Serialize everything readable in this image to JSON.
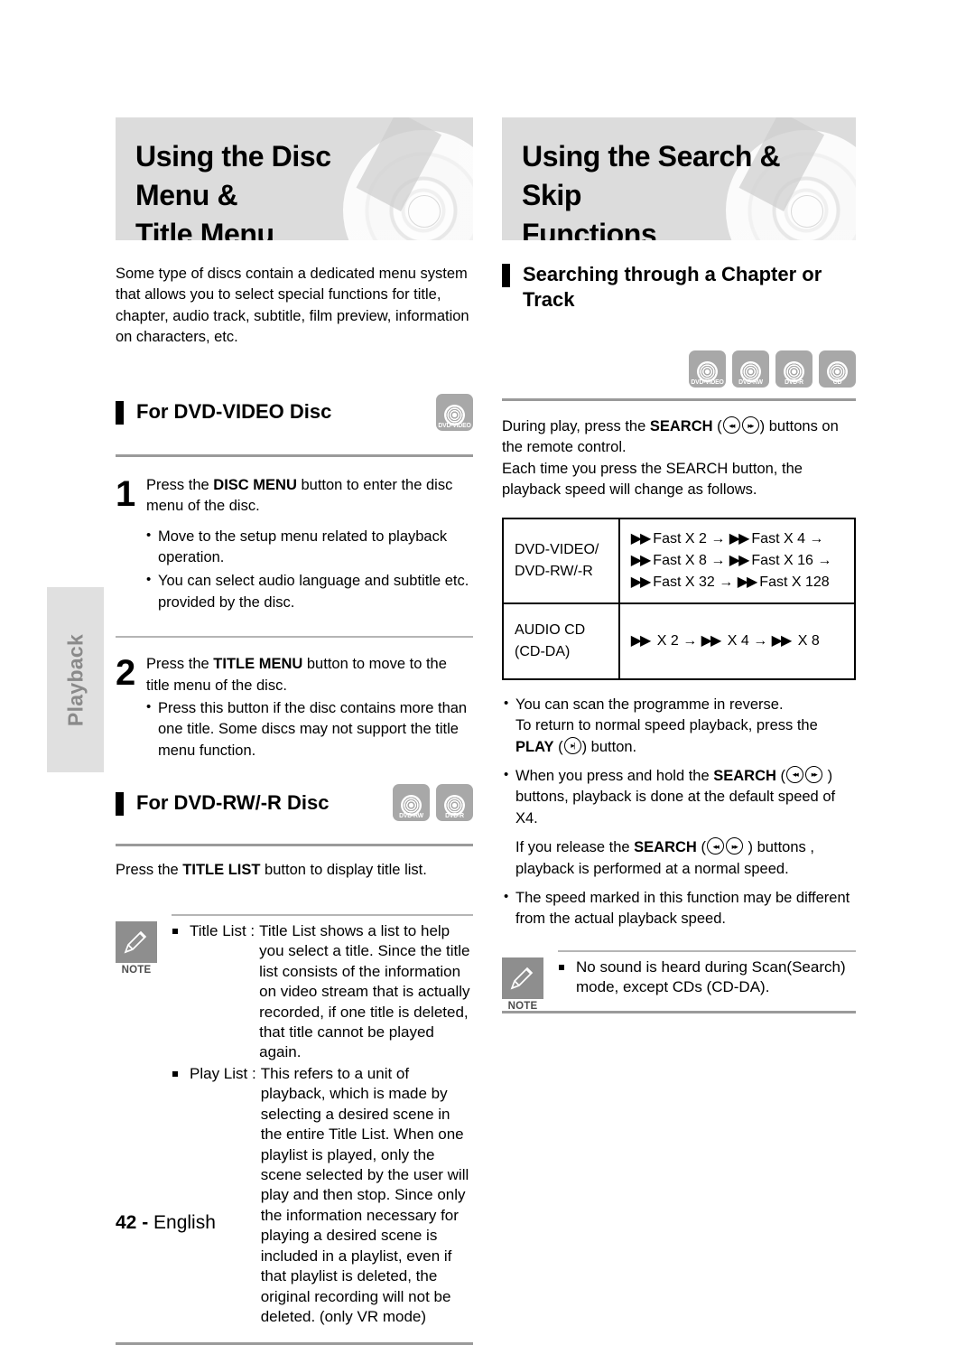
{
  "side_tab": {
    "label": "Playback"
  },
  "footer": {
    "page_number": "42 -",
    "language": "English"
  },
  "left": {
    "banner_title_line1": "Using the Disc Menu &",
    "banner_title_line2": "Title Menu",
    "intro": "Some type of discs contain a dedicated menu system that allows you to select special functions for title, chapter, audio track, subtitle, film preview, information on characters, etc.",
    "section_dvd_video": {
      "heading": "For DVD-VIDEO Disc",
      "badges": [
        {
          "label": "DVD-VIDEO"
        }
      ]
    },
    "step1": {
      "number": "1",
      "text_before": "Press the ",
      "text_bold": "DISC MENU",
      "text_after": " button to enter the disc menu of the disc.",
      "bullets": [
        "Move to the setup menu related to playback operation.",
        "You can select audio language and subtitle etc. provided by the disc."
      ]
    },
    "step2": {
      "number": "2",
      "text_before": "Press the ",
      "text_bold": "TITLE MENU",
      "text_after": " button to move to the title menu of the disc.",
      "bullets": [
        "Press this button if the disc contains more than one title. Some discs may not support the title menu function."
      ]
    },
    "section_dvd_rw": {
      "heading": "For DVD-RW/-R Disc",
      "badges": [
        {
          "label": "DVD-RW"
        },
        {
          "label": "DVD-R"
        }
      ]
    },
    "title_list_line": {
      "before": "Press the ",
      "bold": "TITLE LIST",
      "after": " button to display title list."
    },
    "note": {
      "icon_label": "NOTE",
      "items": [
        {
          "term": "Title List :",
          "definition": "Title List shows a list to help you select a title. Since the title list consists of the information on video stream that is actually recorded, if one title is deleted, that title cannot be played again."
        },
        {
          "term": "Play List :",
          "definition": "This refers to a unit of playback, which is made by selecting a desired scene in the entire Title List. When one playlist is played, only the scene selected by the user will play and then stop. Since only the information necessary for playing a desired scene is included in a playlist, even if that playlist is deleted, the original recording will not be deleted. (only VR mode)"
        }
      ]
    }
  },
  "right": {
    "banner_title_line1": "Using the Search & Skip",
    "banner_title_line2": "Functions",
    "section_searching": {
      "heading_line1": "Searching through a Chapter or",
      "heading_line2": "Track",
      "badges": [
        {
          "label": "DVD-VIDEO"
        },
        {
          "label": "DVD-RW"
        },
        {
          "label": "DVD-R"
        },
        {
          "label": "CD"
        }
      ]
    },
    "intro_part1_before": "During play, press the ",
    "intro_part1_bold": "SEARCH",
    "intro_part1_after": " buttons on the remote control.",
    "intro_part2": "Each time you press the SEARCH button, the playback speed will change as follows.",
    "table": {
      "rows": [
        {
          "label_line1": "DVD-VIDEO/",
          "label_line2": "DVD-RW/-R",
          "value_line1": "Fast X 2",
          "value_line2": "Fast X 4",
          "value_line3": "Fast X 8",
          "value_line4": "Fast X 16",
          "value_line5": "Fast X 32",
          "value_line6": "Fast X 128"
        },
        {
          "label_line1": "AUDIO CD",
          "label_line2": "(CD-DA)",
          "value_line1": "X 2",
          "value_line2": "X 4",
          "value_line3": "X 8"
        }
      ],
      "arrow": "→",
      "fast_forward_glyph": "▶▶"
    },
    "bullets": {
      "b1_line1": "You can scan the programme in reverse.",
      "b1_line2": "To return to normal speed playback, press the",
      "b1_bold": "PLAY",
      "b1_after": " button.",
      "b2_before": "When you press and hold the ",
      "b2_bold": "SEARCH",
      "b2_after": " buttons, playback is done at the default speed of X4.",
      "b3_before": "If you release the ",
      "b3_bold": "SEARCH",
      "b3_after": " buttons , playback is performed at a normal speed.",
      "b4": "The speed marked in this function may be different from the actual playback speed."
    },
    "note": {
      "icon_label": "NOTE",
      "item": "No sound is heard during Scan(Search) mode, except CDs (CD-DA)."
    }
  }
}
